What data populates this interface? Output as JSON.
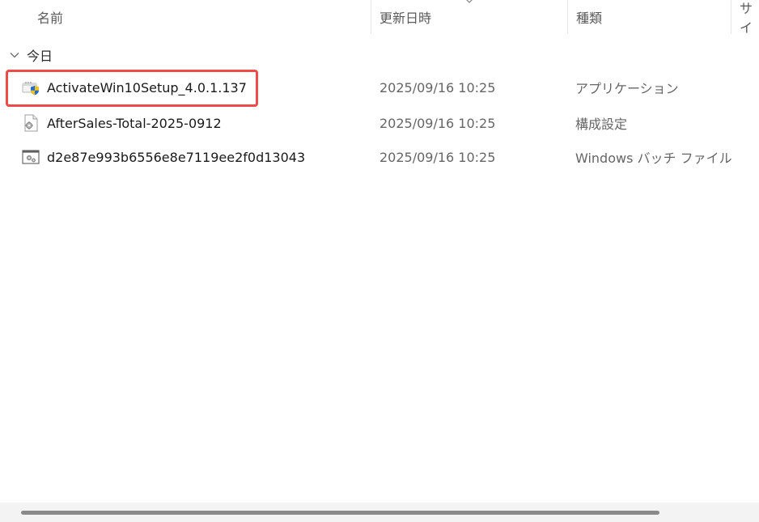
{
  "columns": {
    "name": "名前",
    "date_modified": "更新日時",
    "type": "種類",
    "size": "サイ"
  },
  "group": {
    "label": "今日"
  },
  "files": [
    {
      "name": "ActivateWin10Setup_4.0.1.137",
      "date": "2025/09/16 10:25",
      "type": "アプリケーション",
      "icon": "application-installer-icon"
    },
    {
      "name": "AfterSales-Total-2025-0912",
      "date": "2025/09/16 10:25",
      "type": "構成設定",
      "icon": "config-settings-file-icon"
    },
    {
      "name": "d2e87e993b6556e8e7119ee2f0d13043",
      "date": "2025/09/16 10:25",
      "type": "Windows バッチ ファイル",
      "icon": "batch-file-icon"
    }
  ],
  "colors": {
    "highlight_border": "#ef4a4a",
    "header_text": "#5a5a5a",
    "secondary_text": "#666666"
  }
}
